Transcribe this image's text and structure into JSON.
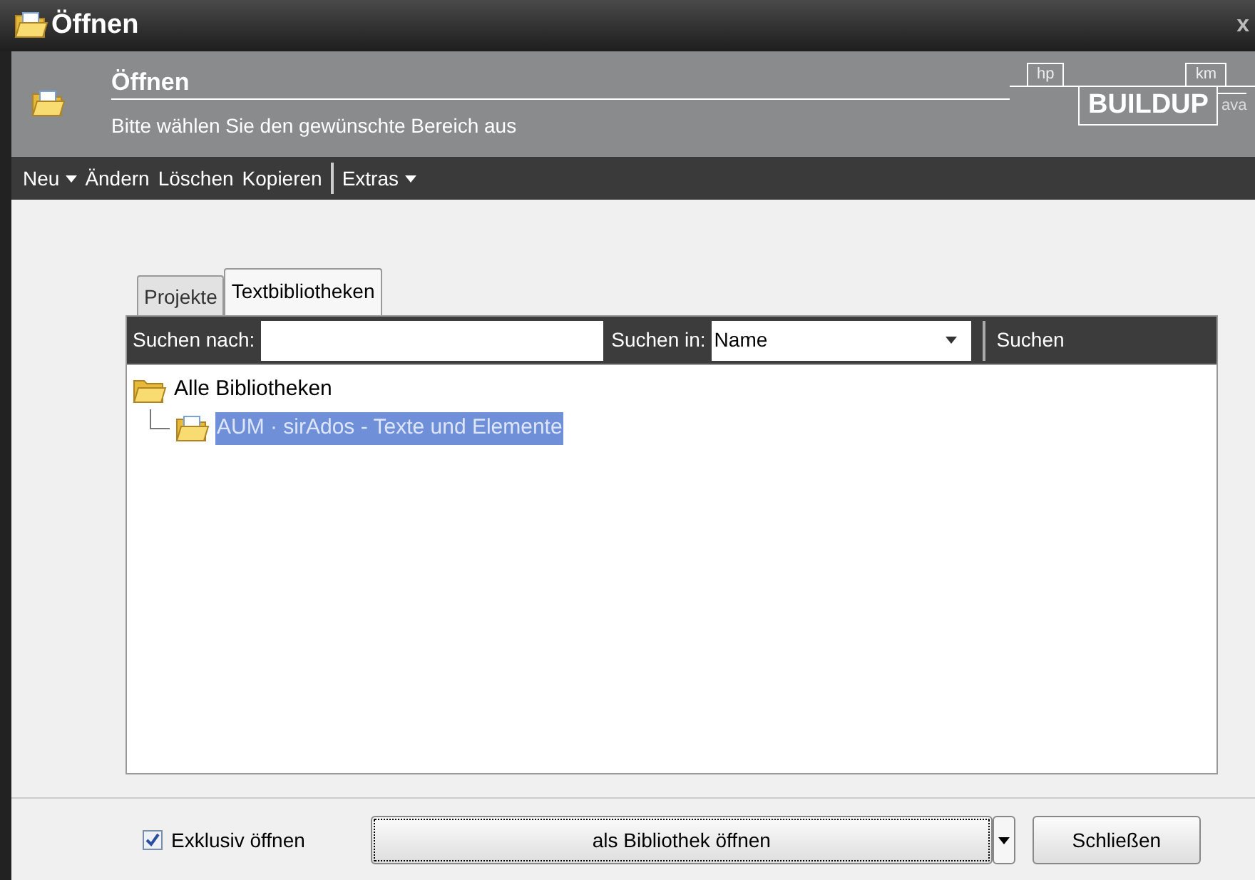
{
  "window": {
    "title": "Öffnen",
    "close": "x"
  },
  "header": {
    "title": "Öffnen",
    "subtitle": "Bitte wählen Sie den gewünschte Bereich aus",
    "logo": {
      "left_tag": "hp",
      "right_tag": "km",
      "name": "BUILDUP",
      "side_tag": "ava"
    }
  },
  "toolbar": {
    "groups": [
      {
        "items": [
          {
            "label": "Neu",
            "dropdown": true
          },
          {
            "label": "Ändern",
            "dropdown": false
          },
          {
            "label": "Löschen",
            "dropdown": false
          },
          {
            "label": "Kopieren",
            "dropdown": false
          }
        ]
      },
      {
        "items": [
          {
            "label": "Extras",
            "dropdown": true
          }
        ]
      }
    ]
  },
  "tabs": [
    {
      "label": "Projekte",
      "selected": false
    },
    {
      "label": "Textbibliotheken",
      "selected": true
    }
  ],
  "search": {
    "label": "Suchen nach:",
    "in_label": "Suchen in:",
    "in_value": "Name",
    "button": "Suchen"
  },
  "tree": [
    {
      "label": "Alle Bibliotheken",
      "selected": false,
      "children": [
        {
          "label": "AUM · sirAdos - Texte und Elemente",
          "selected": true
        }
      ]
    }
  ],
  "footer": {
    "checkbox": {
      "label": "Exklusiv öffnen",
      "checked": true
    },
    "primary": "als Bibliothek öffnen",
    "close": "Schließen"
  }
}
